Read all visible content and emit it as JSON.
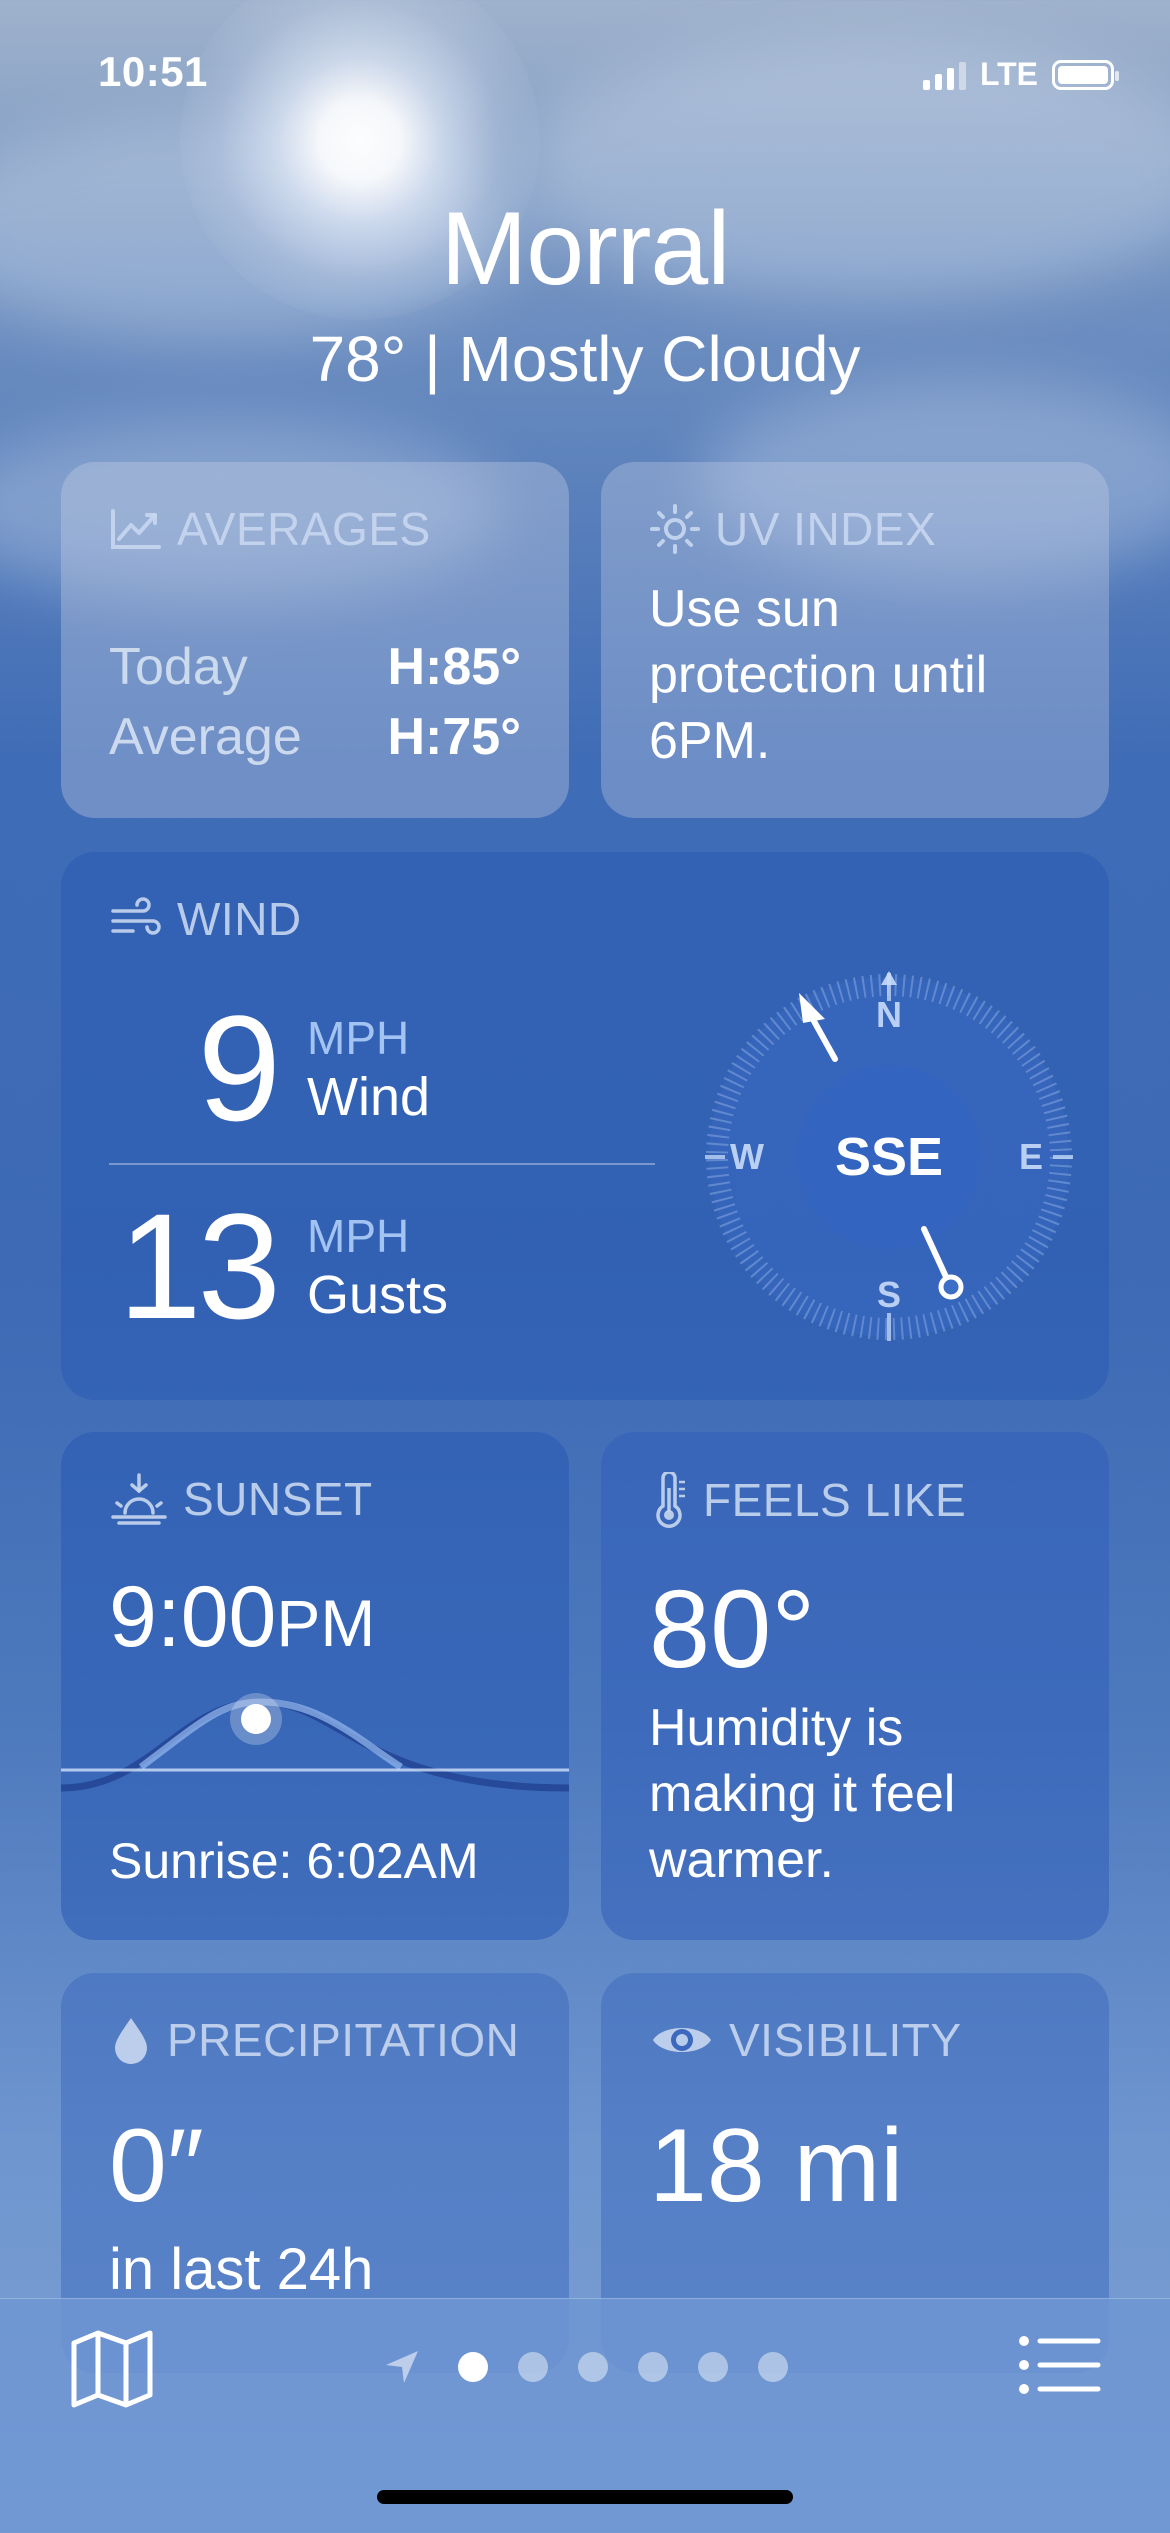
{
  "status_bar": {
    "time": "10:51",
    "network": "LTE"
  },
  "header": {
    "city": "Morral",
    "summary": "78° | Mostly Cloudy"
  },
  "averages": {
    "title": "AVERAGES",
    "rows": [
      {
        "label": "Today",
        "value": "H:85°"
      },
      {
        "label": "Average",
        "value": "H:75°"
      }
    ]
  },
  "uv_index": {
    "title": "UV INDEX",
    "text": "Use sun protection until 6PM."
  },
  "wind": {
    "title": "WIND",
    "wind_speed": "9",
    "wind_unit": "MPH",
    "wind_label": "Wind",
    "gust_speed": "13",
    "gust_unit": "MPH",
    "gust_label": "Gusts",
    "compass": {
      "direction": "SSE",
      "n": "N",
      "e": "E",
      "s": "S",
      "w": "W"
    }
  },
  "sunset": {
    "title": "SUNSET",
    "time": "9:00",
    "time_suffix": "PM",
    "sunrise": "Sunrise: 6:02AM"
  },
  "feels_like": {
    "title": "FEELS LIKE",
    "value": "80°",
    "description": "Humidity is making it feel warmer."
  },
  "precipitation": {
    "title": "PRECIPITATION",
    "value": "0″",
    "sub": "in last 24h"
  },
  "visibility": {
    "title": "VISIBILITY",
    "value": "18 mi"
  },
  "pager": {
    "page_count": 6,
    "active_index": 0
  },
  "icons": {
    "averages": "chart-line-icon",
    "uv": "sun-icon",
    "wind": "wind-icon",
    "sunset": "sunset-icon",
    "feels": "thermometer-icon",
    "precip": "drop-icon",
    "vis": "eye-icon",
    "map": "map-icon",
    "list": "list-icon",
    "location": "location-arrow-icon"
  },
  "colors": {
    "card_label": "#c8d7f0",
    "unit_blue": "#aac8f5"
  }
}
